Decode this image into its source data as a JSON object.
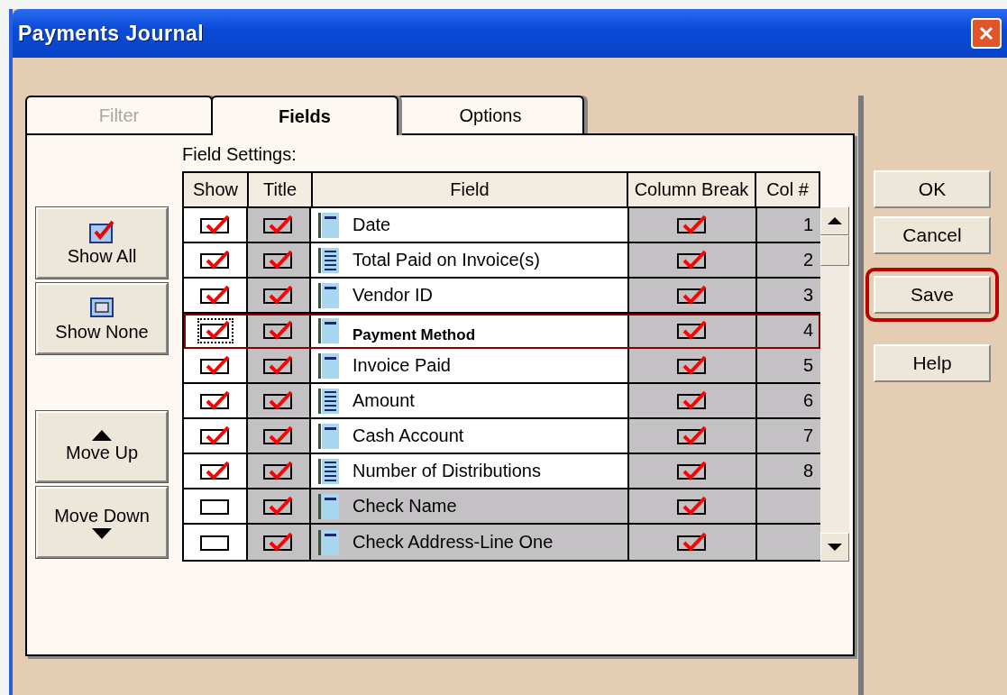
{
  "window": {
    "title": "Payments Journal"
  },
  "tabs": [
    {
      "label": "Filter",
      "selected": false,
      "disabled": true
    },
    {
      "label": "Fields",
      "selected": true,
      "disabled": false
    },
    {
      "label": "Options",
      "selected": false,
      "disabled": false
    }
  ],
  "left_buttons": [
    {
      "label": "Show All",
      "kind": "all"
    },
    {
      "label": "Show None",
      "kind": "none"
    },
    {
      "label": "Move Up",
      "kind": "up"
    },
    {
      "label": "Move Down",
      "kind": "down"
    }
  ],
  "field_settings": {
    "label": "Field Settings:",
    "columns": [
      "Show",
      "Title",
      "Field",
      "Column Break",
      "Col #"
    ],
    "rows": [
      {
        "show": true,
        "title": true,
        "kind": "single",
        "field": "Date",
        "column_break": true,
        "col": "1",
        "selected": false
      },
      {
        "show": true,
        "title": true,
        "kind": "list",
        "field": "Total Paid on Invoice(s)",
        "column_break": true,
        "col": "2",
        "selected": false
      },
      {
        "show": true,
        "title": true,
        "kind": "single",
        "field": "Vendor ID",
        "column_break": true,
        "col": "3",
        "selected": false
      },
      {
        "show": true,
        "title": true,
        "kind": "single",
        "field": "Payment Method",
        "column_break": true,
        "col": "4",
        "selected": true
      },
      {
        "show": true,
        "title": true,
        "kind": "single",
        "field": "Invoice Paid",
        "column_break": true,
        "col": "5",
        "selected": false
      },
      {
        "show": true,
        "title": true,
        "kind": "list",
        "field": "Amount",
        "column_break": true,
        "col": "6",
        "selected": false
      },
      {
        "show": true,
        "title": true,
        "kind": "single",
        "field": "Cash Account",
        "column_break": true,
        "col": "7",
        "selected": false
      },
      {
        "show": true,
        "title": true,
        "kind": "list",
        "field": "Number of Distributions",
        "column_break": true,
        "col": "8",
        "selected": false
      },
      {
        "show": false,
        "title": true,
        "kind": "single",
        "field": "Check Name",
        "column_break": true,
        "selected": false
      },
      {
        "show": false,
        "title": true,
        "kind": "single",
        "field": "Check Address-Line One",
        "column_break": true,
        "selected": false
      }
    ]
  },
  "right_buttons": [
    {
      "label": "OK",
      "highlighted": false
    },
    {
      "label": "Cancel",
      "highlighted": false
    },
    {
      "label": "Save",
      "highlighted": true
    },
    {
      "label": "Help",
      "highlighted": false
    }
  ]
}
